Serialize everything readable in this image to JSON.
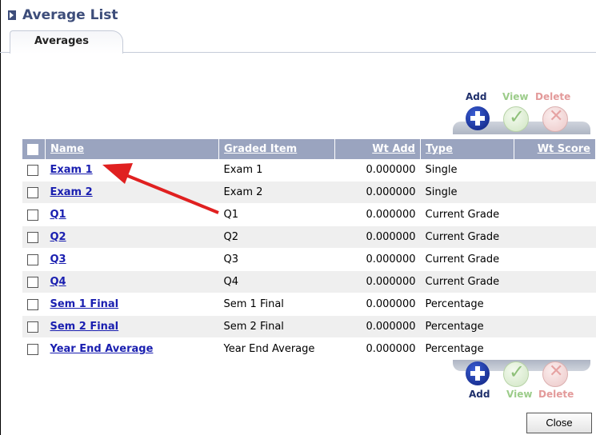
{
  "window": {
    "title": "Average List"
  },
  "tabs": [
    {
      "label": "Averages"
    }
  ],
  "toolbar": {
    "add_label": "Add",
    "view_label": "View",
    "delete_label": "Delete"
  },
  "table": {
    "headers": {
      "name": "Name",
      "graded_item": "Graded Item",
      "wt_add": "Wt Add",
      "type": "Type",
      "wt_score": "Wt Score"
    },
    "rows": [
      {
        "name": "Exam 1",
        "graded_item": "Exam 1",
        "wt_add": "0.000000",
        "type": "Single"
      },
      {
        "name": "Exam 2",
        "graded_item": "Exam 2",
        "wt_add": "0.000000",
        "type": "Single"
      },
      {
        "name": "Q1",
        "graded_item": "Q1",
        "wt_add": "0.000000",
        "type": "Current Grade"
      },
      {
        "name": "Q2",
        "graded_item": "Q2",
        "wt_add": "0.000000",
        "type": "Current Grade"
      },
      {
        "name": "Q3",
        "graded_item": "Q3",
        "wt_add": "0.000000",
        "type": "Current Grade"
      },
      {
        "name": "Q4",
        "graded_item": "Q4",
        "wt_add": "0.000000",
        "type": "Current Grade"
      },
      {
        "name": "Sem 1 Final",
        "graded_item": "Sem 1 Final",
        "wt_add": "0.000000",
        "type": "Percentage"
      },
      {
        "name": "Sem 2 Final",
        "graded_item": "Sem 2 Final",
        "wt_add": "0.000000",
        "type": "Percentage"
      },
      {
        "name": "Year End Average",
        "graded_item": "Year End Average",
        "wt_add": "0.000000",
        "type": "Percentage"
      }
    ]
  },
  "footer": {
    "close_label": "Close"
  },
  "colors": {
    "header_bg": "#9aa4bf",
    "link": "#1a1fb0",
    "annotation_arrow": "#e02020"
  }
}
